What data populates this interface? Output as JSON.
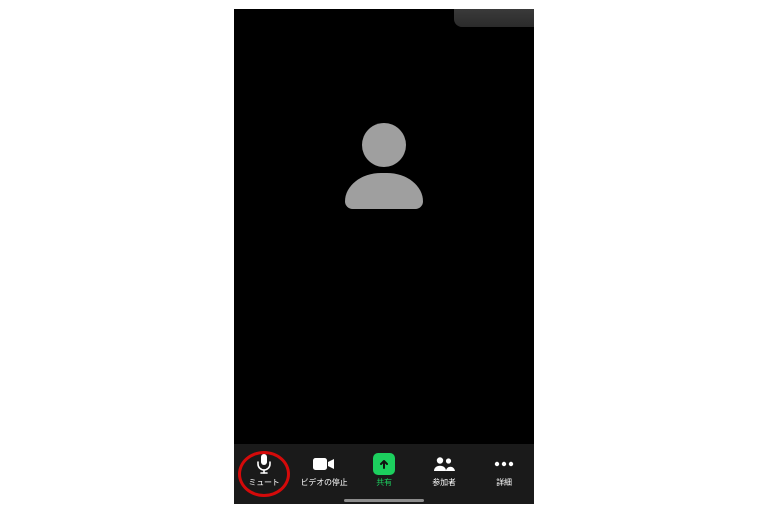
{
  "toolbar": {
    "mute": {
      "label": "ミュート",
      "icon": "microphone-icon"
    },
    "stop_video": {
      "label": "ビデオの停止",
      "icon": "video-camera-icon"
    },
    "share": {
      "label": "共有",
      "icon": "share-arrow-icon"
    },
    "participants": {
      "label": "参加者",
      "icon": "participants-icon"
    },
    "more": {
      "label": "詳細",
      "icon": "more-icon"
    }
  },
  "colors": {
    "accent": "#1ccf5e",
    "highlight_ring": "#d40a0a",
    "avatar": "#9f9f9f",
    "toolbar_bg": "#1a1a1a"
  },
  "highlighted_control": "mute"
}
